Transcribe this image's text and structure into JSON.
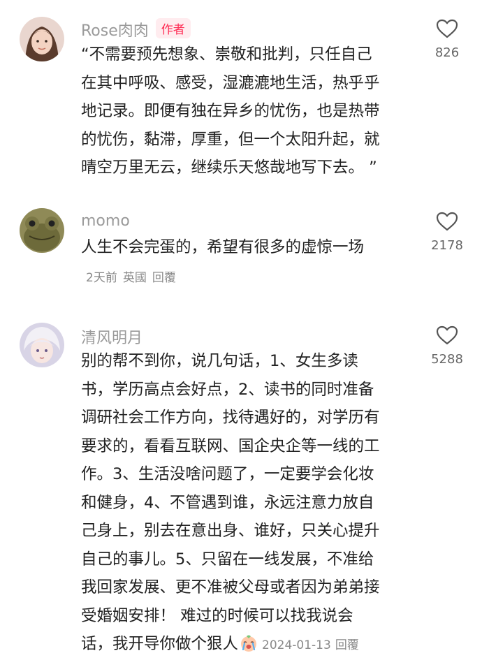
{
  "comments": [
    {
      "username": "Rose肉肉",
      "badge": "作者",
      "lines": [
        "“不需要预先想象、崇敬和批判，只任自己",
        "在其中呼吸、感受，湿漉漉地生活，热乎乎",
        "地记录。即便有独在异乡的忧伤，也是热带",
        "的忧伤，黏滞，厚重，但一个太阳升起，就",
        "晴空万里无云，继续乐天悠哉地写下去。 ”"
      ],
      "likes": "826"
    },
    {
      "username": "momo",
      "lines": [
        "人生不会完蛋的，希望有很多的虚惊一场"
      ],
      "time": "2天前",
      "location": "英國",
      "reply": "回覆",
      "likes": "2178"
    },
    {
      "username": "清风明月",
      "lines": [
        "别的帮不到你，说几句话，1、女生多读",
        "书，学历高点会好点，2、读书的同时准备",
        "调研社会工作方向，找待遇好的，对学历有",
        "要求的，看看互联网、国企央企等一线的工",
        "作。3、生活没啥问题了，一定要学会化妆",
        "和健身，4、不管遇到谁，永远注意力放自",
        "己身上，别去在意出身、谁好，只关心提升",
        "自己的事儿。5、只留在一线发展，不准给",
        "我回家发展、更不准被父母或者因为弟弟接",
        "受婚姻安排！  难过的时候可以找我说会",
        "话，我开导你做个狠人"
      ],
      "emoji": "crying-face-icon",
      "time": "2024-01-13",
      "reply": "回覆",
      "likes": "5288"
    }
  ],
  "colors": {
    "username": "#9a9a9a",
    "badge_text": "#ff2d55",
    "badge_bg": "#ffecef",
    "meta": "#8a8a8a",
    "body_text": "#222222"
  }
}
